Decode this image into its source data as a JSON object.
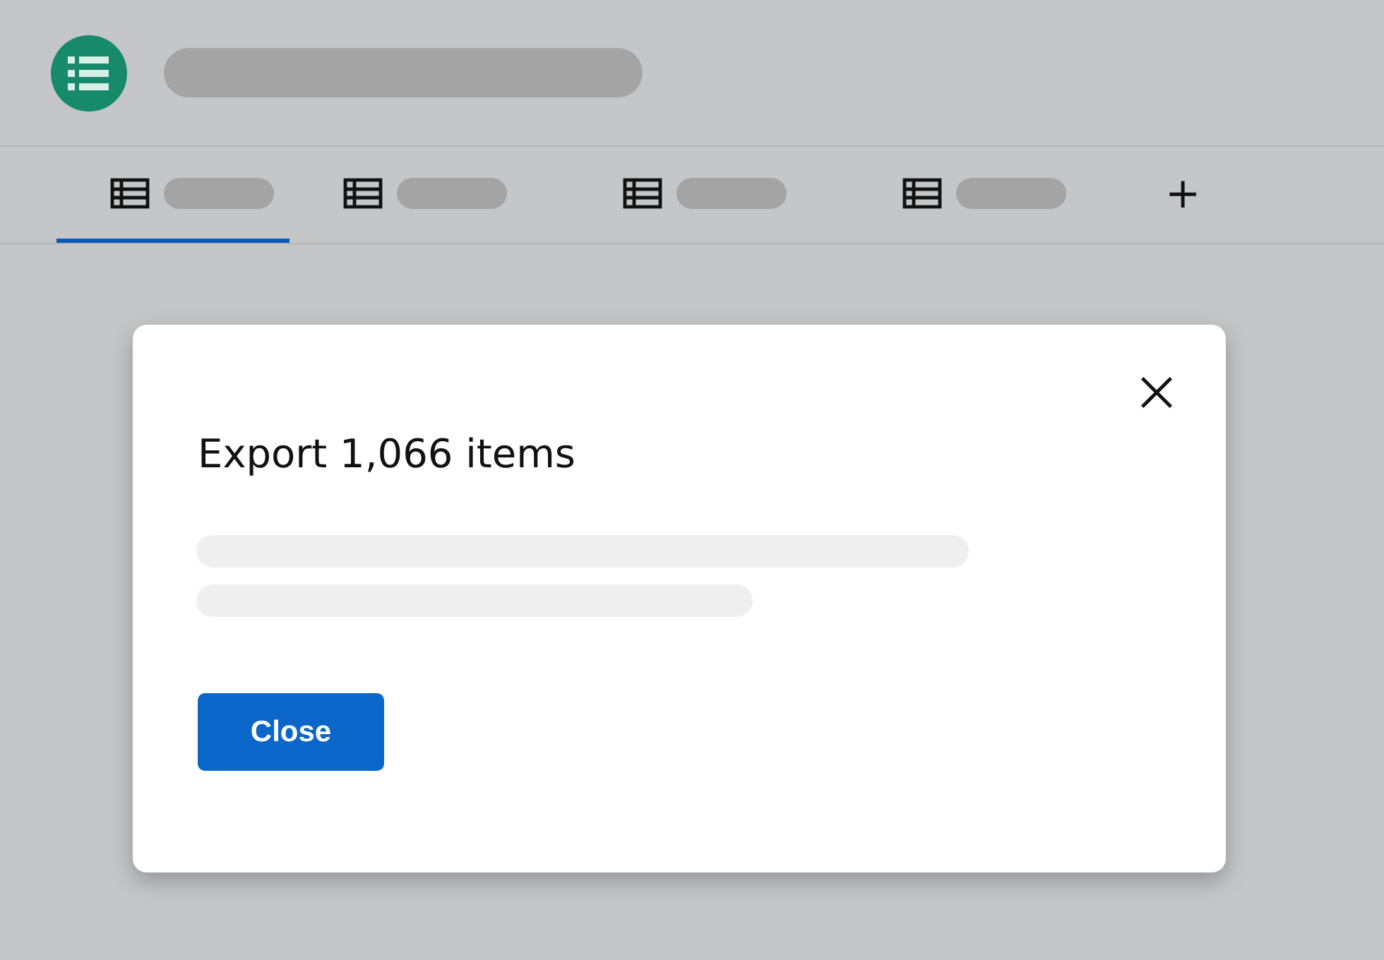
{
  "tabs": [
    {
      "selected": true
    },
    {
      "selected": false
    },
    {
      "selected": false
    },
    {
      "selected": false
    }
  ],
  "add_tab": "+",
  "dialog": {
    "title": "Export 1,066 items",
    "button": "Close"
  }
}
